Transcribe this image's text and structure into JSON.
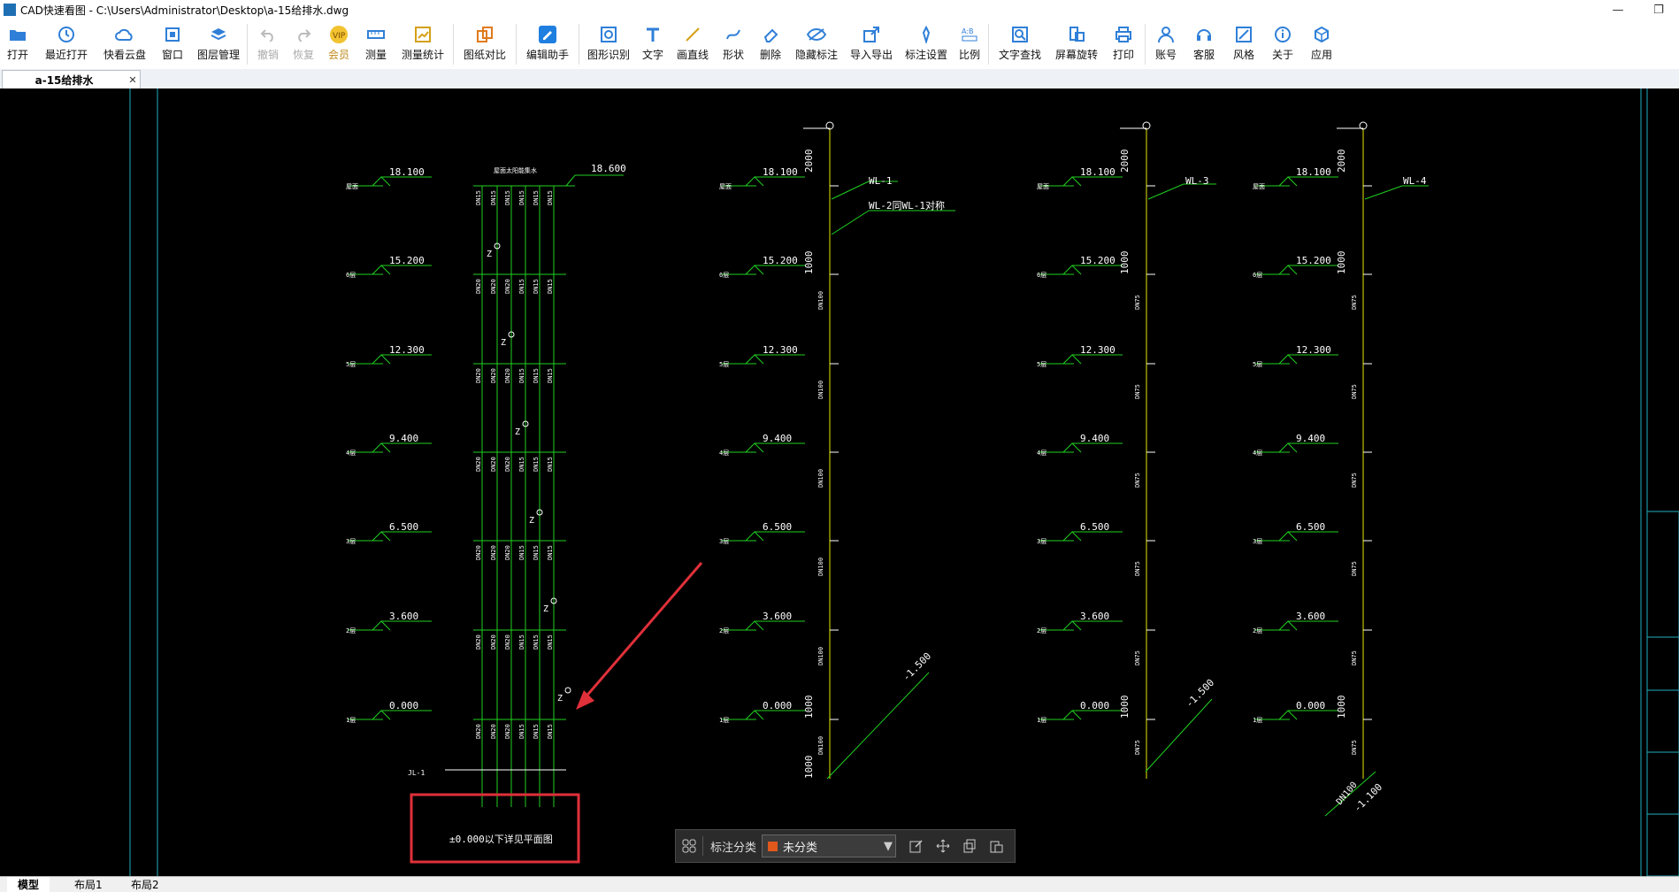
{
  "window": {
    "title": "CAD快速看图 - C:\\Users\\Administrator\\Desktop\\a-15给排水.dwg",
    "minimize": "—",
    "restore": "❐"
  },
  "toolbar": {
    "open": "打开",
    "recent": "最近打开",
    "cloud": "快看云盘",
    "window": "窗口",
    "layers": "图层管理",
    "undo": "撤销",
    "redo": "恢复",
    "vip": "会员",
    "measure": "测量",
    "measure_stats": "测量统计",
    "compare": "图纸对比",
    "edit_helper": "编辑助手",
    "shape_recog": "图形识别",
    "text": "文字",
    "line": "画直线",
    "shape": "形状",
    "delete": "删除",
    "hide_marks": "隐藏标注",
    "import_export": "导入导出",
    "mark_settings": "标注设置",
    "scale": "比例",
    "text_search": "文字查找",
    "rotate": "屏幕旋转",
    "print": "打印",
    "account": "账号",
    "service": "客服",
    "style": "风格",
    "about": "关于",
    "apps": "应用"
  },
  "tab": {
    "name": "a-15给排水",
    "close": "✕"
  },
  "layouts": [
    "模型",
    "布局1",
    "布局2"
  ],
  "floatbar": {
    "label": "标注分类",
    "selected": "未分类",
    "swatch": "#e0581c"
  },
  "drawing": {
    "levels": [
      "18.100",
      "15.200",
      "12.300",
      "9.400",
      "6.500",
      "3.600",
      "0.000"
    ],
    "roof_level": "18.600",
    "roof_note": "屋面太阳能集水",
    "floor_labels": [
      "屋面",
      "6层",
      "5层",
      "4层",
      "3层",
      "2层",
      "1层"
    ],
    "pipe_labels": {
      "wl1": "WL-1",
      "wl2": "WL-2同WL-1对称",
      "wl3": "WL-3",
      "wl4": "WL-4",
      "jl1": "JL-1"
    },
    "dn": [
      "DN15",
      "DN20",
      "DN100",
      "DN75"
    ],
    "dims": {
      "d2000": "2000",
      "d1000": "1000"
    },
    "slopes": [
      "-1.500",
      "-1.500",
      "-1.100"
    ],
    "dn100_slope": "DN100",
    "note_box": "±0.000以下详见平面图",
    "valve": "Z"
  }
}
